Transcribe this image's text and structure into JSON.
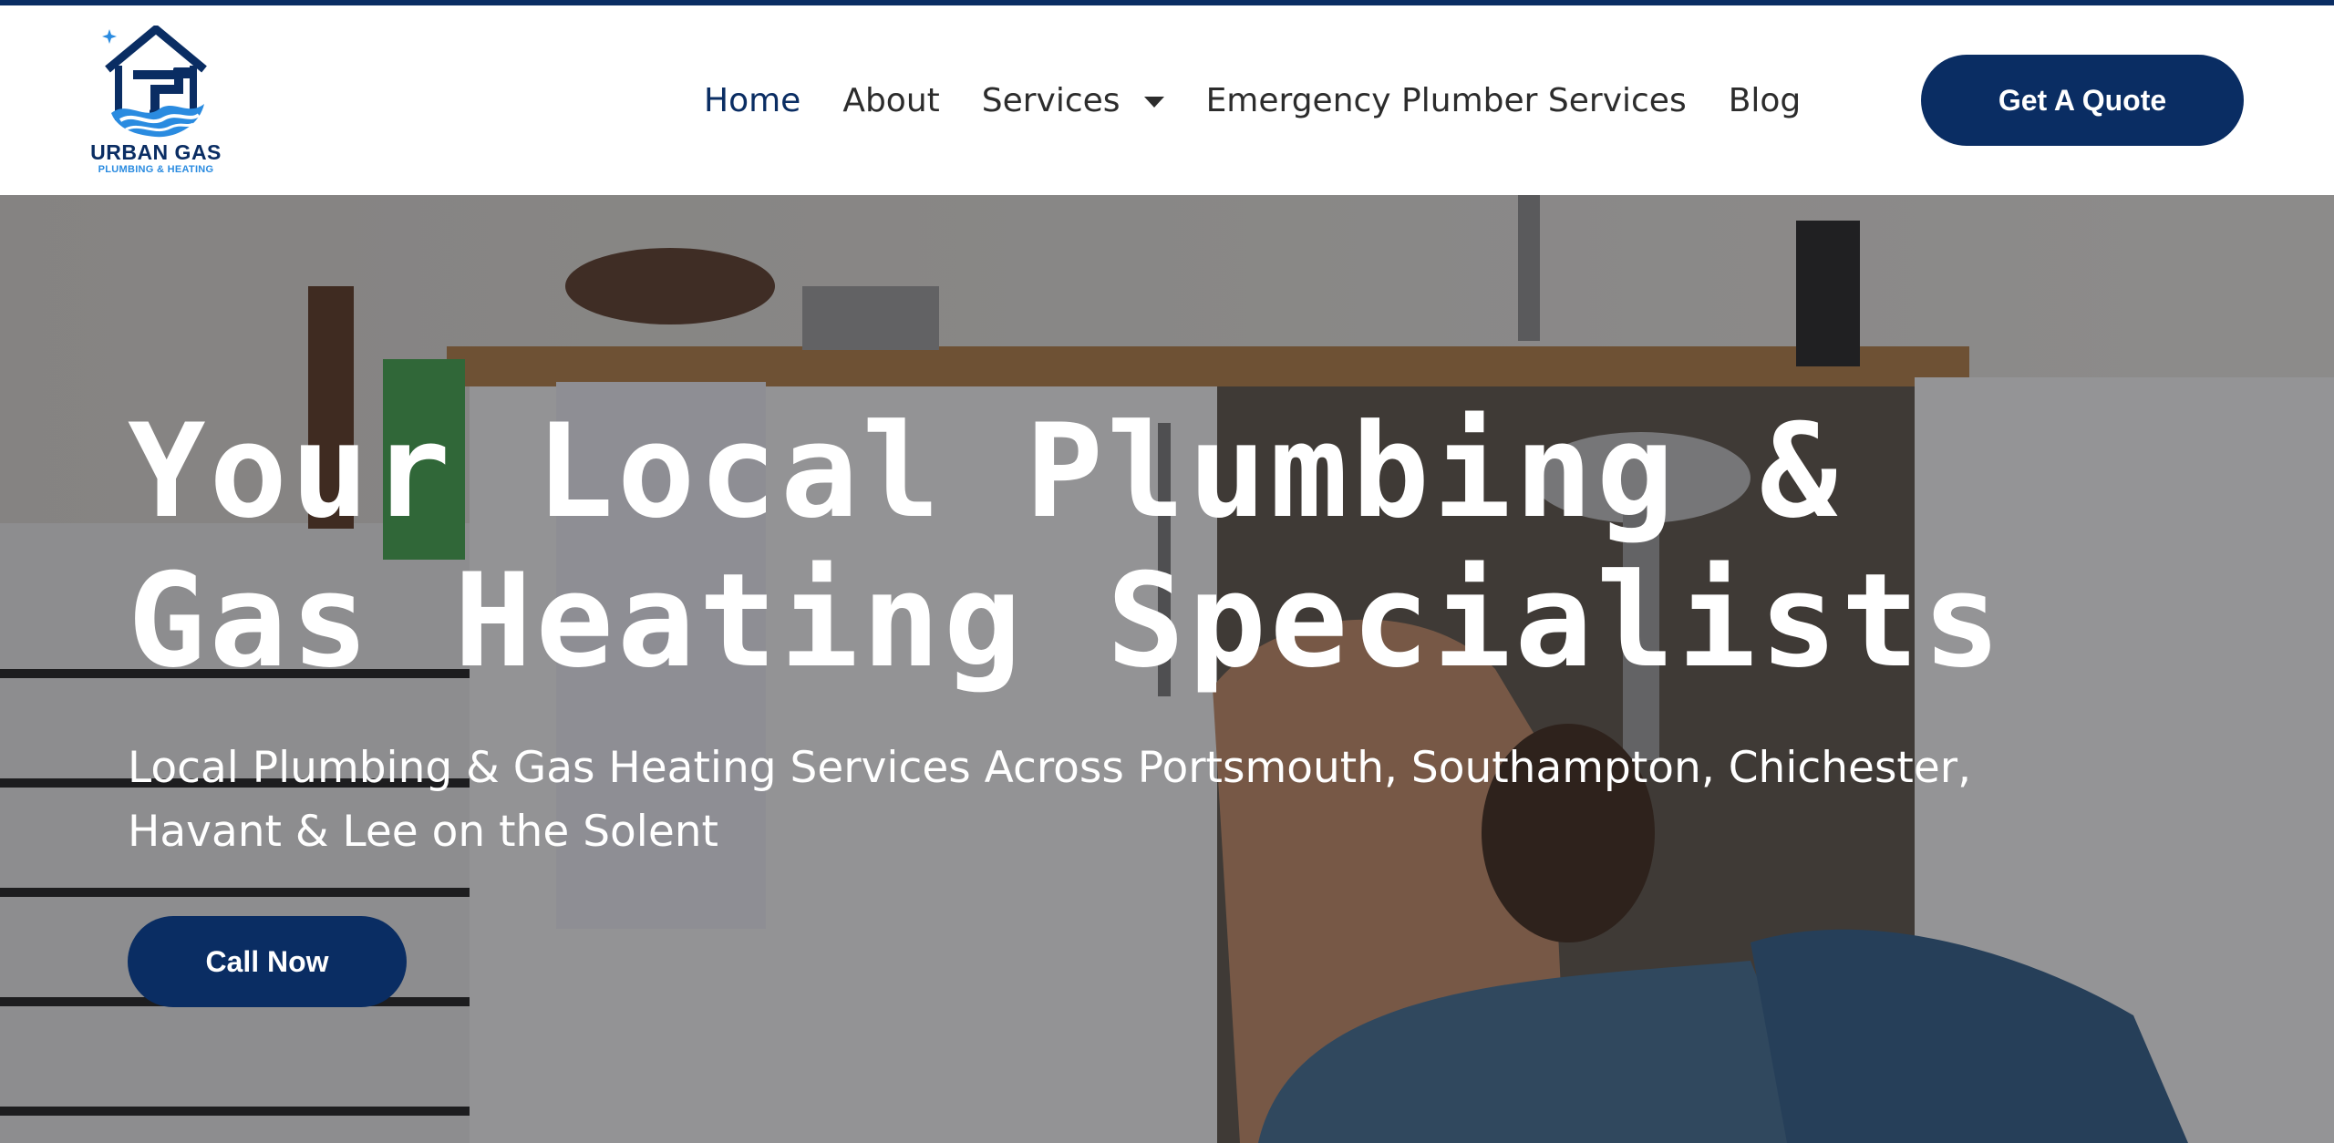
{
  "brand": {
    "name": "URBAN GAS",
    "tagline": "PLUMBING & HEATING",
    "logo_icon": "house-pipe-water-logo",
    "primary_color": "#0a2d63",
    "accent_color": "#2a8be0"
  },
  "nav": {
    "items": [
      {
        "label": "Home",
        "active": true
      },
      {
        "label": "About",
        "active": false
      },
      {
        "label": "Services",
        "active": false,
        "dropdown": true
      },
      {
        "label": "Emergency Plumber Services",
        "active": false
      },
      {
        "label": "Blog",
        "active": false
      }
    ],
    "cta_label": "Get A Quote"
  },
  "hero": {
    "title_line1": "Your Local Plumbing &",
    "title_line2": "Gas Heating Specialists",
    "subtitle": "Local Plumbing & Gas Heating Services Across Portsmouth, Southampton, Chichester, Havant & Lee on the Solent",
    "cta_label": "Call Now",
    "background_image": "plumber-under-kitchen-sink-photo"
  }
}
